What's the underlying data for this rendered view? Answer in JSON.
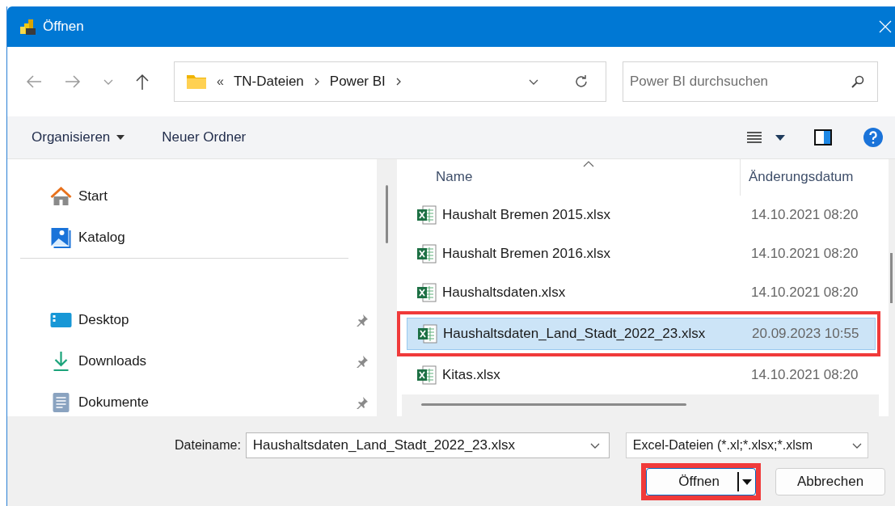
{
  "window": {
    "title": "Öffnen"
  },
  "address_bar": {
    "overflow": "«",
    "segments": [
      "TN-Dateien",
      "Power BI"
    ]
  },
  "search": {
    "placeholder": "Power BI durchsuchen"
  },
  "toolbar": {
    "items": [
      {
        "label": "Organisieren",
        "kind": "menu"
      },
      {
        "label": "Neuer Ordner",
        "kind": "button"
      }
    ]
  },
  "sidebar": {
    "groups": [
      {
        "items": [
          {
            "label": "Start",
            "kind": "home",
            "pinned": false
          },
          {
            "label": "Katalog",
            "kind": "gallery",
            "pinned": false
          }
        ]
      },
      {
        "items": [
          {
            "label": "Desktop",
            "kind": "desktop",
            "pinned": true
          },
          {
            "label": "Downloads",
            "kind": "download",
            "pinned": true
          },
          {
            "label": "Dokumente",
            "kind": "document",
            "pinned": true
          }
        ]
      }
    ]
  },
  "file_list": {
    "columns": [
      "Name",
      "Änderungsdatum"
    ],
    "rows": [
      {
        "name": "Haushalt Bremen 2015.xlsx",
        "modified": "14.10.2021 08:20",
        "selected": false,
        "highlighted": false
      },
      {
        "name": "Haushalt Bremen 2016.xlsx",
        "modified": "14.10.2021 08:20",
        "selected": false,
        "highlighted": false
      },
      {
        "name": "Haushaltsdaten.xlsx",
        "modified": "14.10.2021 08:20",
        "selected": false,
        "highlighted": false
      },
      {
        "name": "Haushaltsdaten_Land_Stadt_2022_23.xlsx",
        "modified": "20.09.2023 10:55",
        "selected": true,
        "highlighted": true
      },
      {
        "name": "Kitas.xlsx",
        "modified": "14.10.2021 08:20",
        "selected": false,
        "highlighted": false
      }
    ]
  },
  "footer": {
    "filename_label": "Dateiname:",
    "filename": "Haushaltsdaten_Land_Stadt_2022_23.xlsx",
    "file_type": "Excel-Dateien (*.xl;*.xlsx;*.xlsm",
    "buttons": [
      {
        "label": "Öffnen",
        "kind": "split",
        "highlighted": true
      },
      {
        "label": "Abbrechen",
        "kind": "plain",
        "highlighted": false
      }
    ]
  }
}
